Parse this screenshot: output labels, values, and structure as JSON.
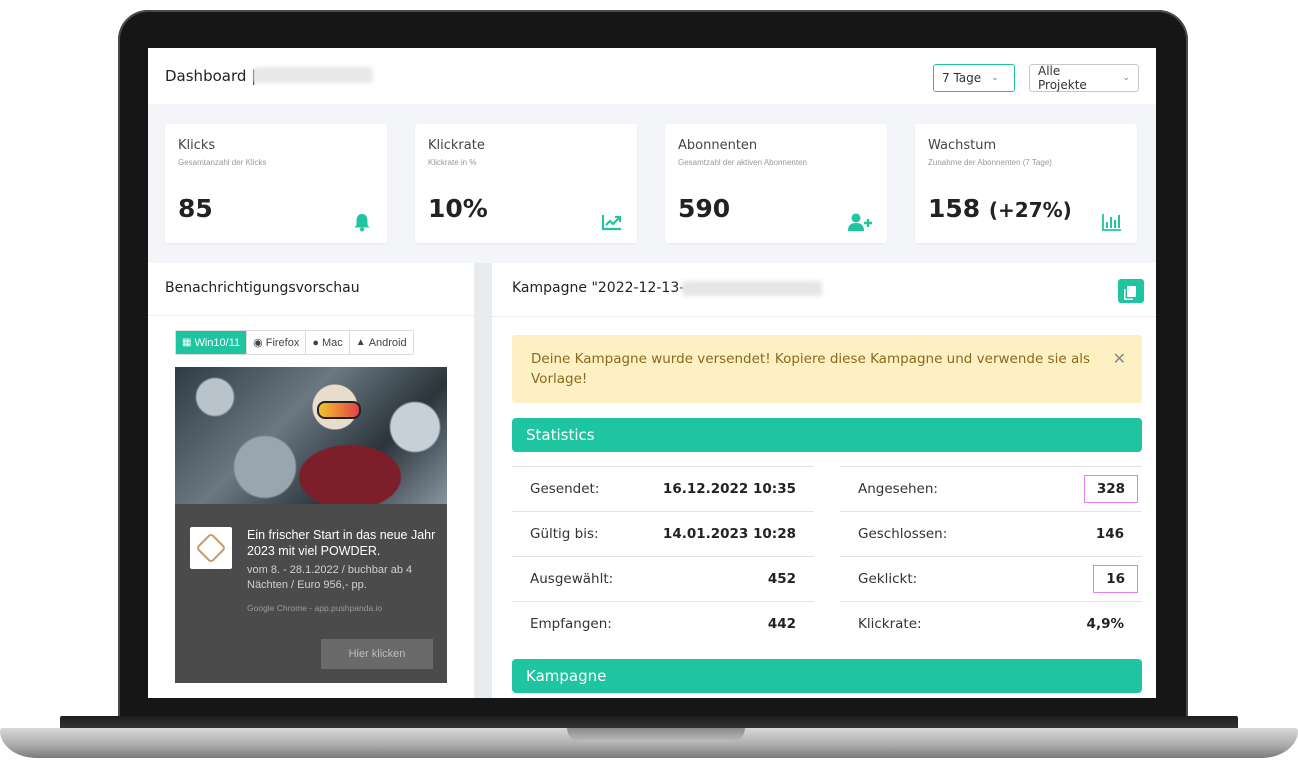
{
  "header": {
    "title": "Dashboard |",
    "period_select": "7 Tage",
    "project_select": "Alle Projekte"
  },
  "cards": [
    {
      "title": "Klicks",
      "subtitle": "Gesamtanzahl der Klicks",
      "value": "85",
      "icon": "bell-icon"
    },
    {
      "title": "Klickrate",
      "subtitle": "Klickrate in %",
      "value": "10%",
      "icon": "trend-chart-icon"
    },
    {
      "title": "Abonnenten",
      "subtitle": "Gesamtzahl der aktiven Abonnenten",
      "value": "590",
      "icon": "add-user-icon"
    },
    {
      "title": "Wachstum",
      "subtitle": "Zunahme der Abonnenten (7 Tage)",
      "value": "158",
      "value_extra": "(+27%)",
      "icon": "bar-chart-icon"
    }
  ],
  "preview": {
    "title": "Benachrichtigungsvorschau",
    "tabs": [
      "Win10/11",
      "Firefox",
      "Mac",
      "Android"
    ],
    "active_tab": "Win10/11",
    "notification": {
      "headline": "Ein frischer Start in das neue Jahr 2023 mit viel POWDER.",
      "body": "vom 8. - 28.1.2022 / buchbar ab 4 Nächten / Euro 956,- pp.",
      "source": "Google Chrome - app.pushpanda.io",
      "button": "Hier klicken"
    }
  },
  "campaign": {
    "title": "Kampagne \"2022-12-13-",
    "alert": "Deine Kampagne wurde versendet! Kopiere diese Kampagne und verwende sie als Vorlage!",
    "statistics_label": "Statistics",
    "campaign_label": "Kampagne",
    "stats_left": [
      {
        "label": "Gesendet:",
        "value": "16.12.2022 10:35"
      },
      {
        "label": "Gültig bis:",
        "value": "14.01.2023 10:28"
      },
      {
        "label": "Ausgewählt:",
        "value": "452"
      },
      {
        "label": "Empfangen:",
        "value": "442"
      }
    ],
    "stats_right": [
      {
        "label": "Angesehen:",
        "value": "328"
      },
      {
        "label": "Geschlossen:",
        "value": "146"
      },
      {
        "label": "Geklickt:",
        "value": "16"
      },
      {
        "label": "Klickrate:",
        "value": "4,9%"
      }
    ]
  },
  "colors": {
    "accent": "#1ec5a0",
    "alert_bg": "#fdf1c4",
    "highlight_box": "#e27ff0"
  }
}
